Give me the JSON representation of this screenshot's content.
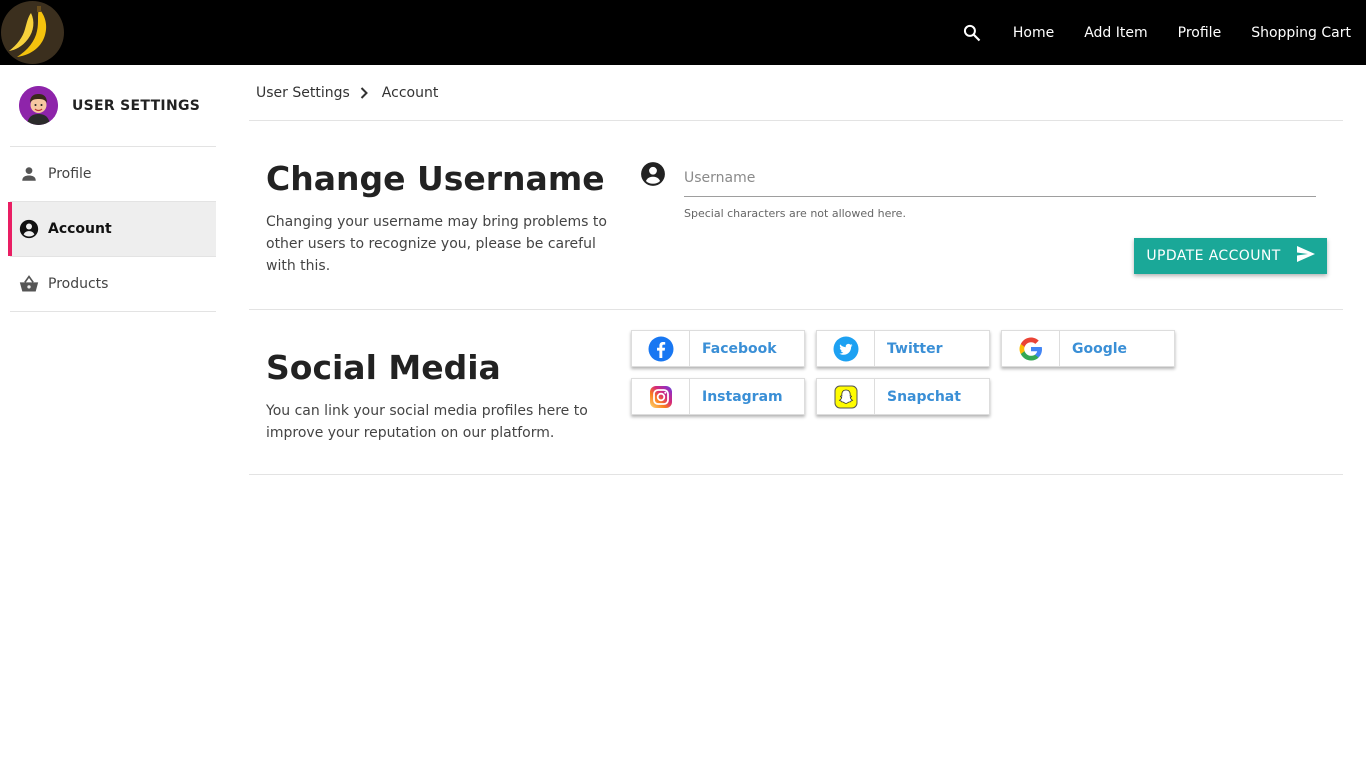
{
  "nav": {
    "items": [
      {
        "label": "Home"
      },
      {
        "label": "Add Item"
      },
      {
        "label": "Profile"
      },
      {
        "label": "Shopping Cart"
      }
    ]
  },
  "sidebar": {
    "title": "USER SETTINGS",
    "items": [
      {
        "label": "Profile",
        "icon": "person-icon"
      },
      {
        "label": "Account",
        "icon": "account-circle-icon",
        "active": true
      },
      {
        "label": "Products",
        "icon": "basket-icon"
      }
    ]
  },
  "breadcrumb": {
    "items": [
      "User Settings",
      "Account"
    ]
  },
  "username_section": {
    "title": "Change Username",
    "description": "Changing your username may bring problems to other users to recognize you, please be careful with this.",
    "input_placeholder": "Username",
    "input_value": "",
    "helper": "Special characters are not allowed here.",
    "button_label": "UPDATE ACCOUNT"
  },
  "social_section": {
    "title": "Social Media",
    "description": "You can link your social media profiles here to improve your reputation on our platform.",
    "buttons": [
      {
        "label": "Facebook"
      },
      {
        "label": "Twitter"
      },
      {
        "label": "Google"
      },
      {
        "label": "Instagram"
      },
      {
        "label": "Snapchat"
      }
    ]
  },
  "colors": {
    "topbar": "#000000",
    "accent_teal": "#1aa898",
    "active_marker": "#e91e63",
    "social_text": "#3a8fd6"
  }
}
